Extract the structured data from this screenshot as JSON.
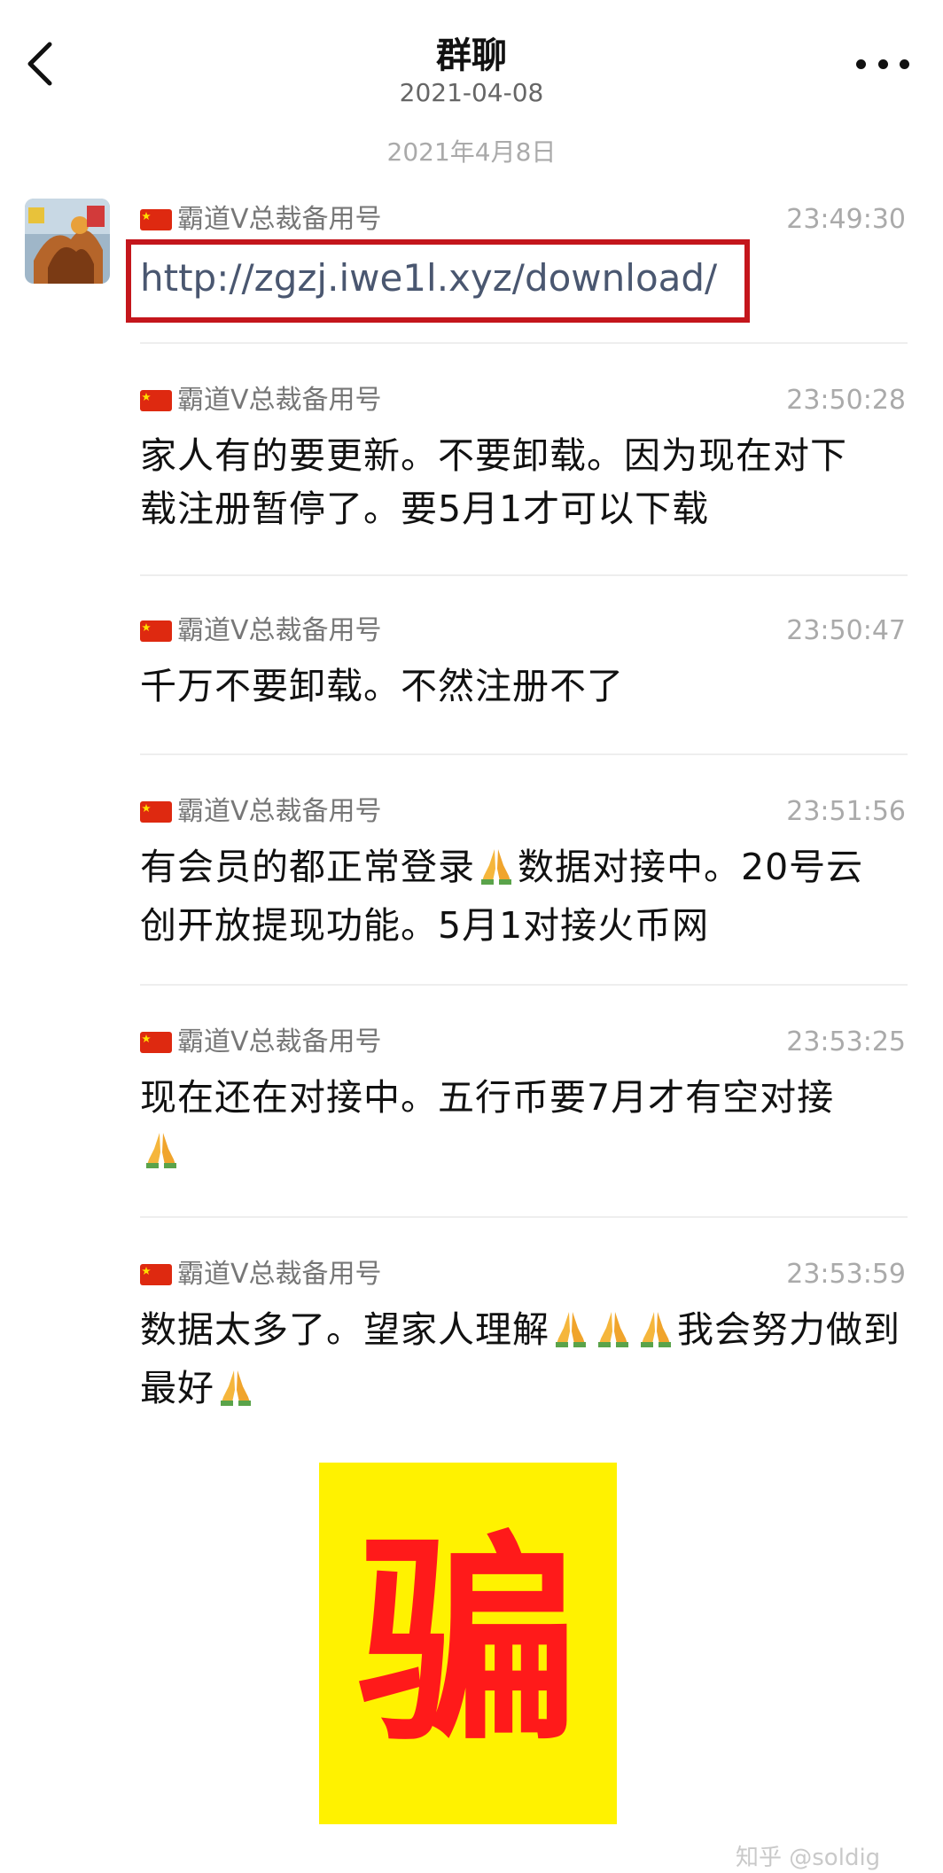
{
  "header": {
    "title": "群聊",
    "subtitle": "2021-04-08"
  },
  "date_separator": "2021年4月8日",
  "messages": [
    {
      "sender": "霸道V总裁备用号",
      "time": "23:49:30",
      "text": "http://zgzj.iwe1l.xyz/download/"
    },
    {
      "sender": "霸道V总裁备用号",
      "time": "23:50:28",
      "text": "家人有的要更新。不要卸载。因为现在对下载注册暂停了。要5月1才可以下载"
    },
    {
      "sender": "霸道V总裁备用号",
      "time": "23:50:47",
      "text": "千万不要卸载。不然注册不了"
    },
    {
      "sender": "霸道V总裁备用号",
      "time": "23:51:56",
      "text_a": "有会员的都正常登录",
      "text_b": "数据对接中。20号云创开放提现功能。5月1对接火币网"
    },
    {
      "sender": "霸道V总裁备用号",
      "time": "23:53:25",
      "text": "现在还在对接中。五行币要7月才有空对接"
    },
    {
      "sender": "霸道V总裁备用号",
      "time": "23:53:59",
      "text_a": "数据太多了。望家人理解",
      "text_b": "我会努力做到最好"
    }
  ],
  "stamp": {
    "text": "骗",
    "bg_color": "#fff200",
    "text_color": "#ff1a1a"
  },
  "watermark": "知乎 @soldig",
  "colors": {
    "link_box": "#c4161c",
    "link_text": "#4a5770"
  },
  "icons": [
    "back-icon",
    "more-icon",
    "china-flag-icon",
    "pray-emoji"
  ]
}
